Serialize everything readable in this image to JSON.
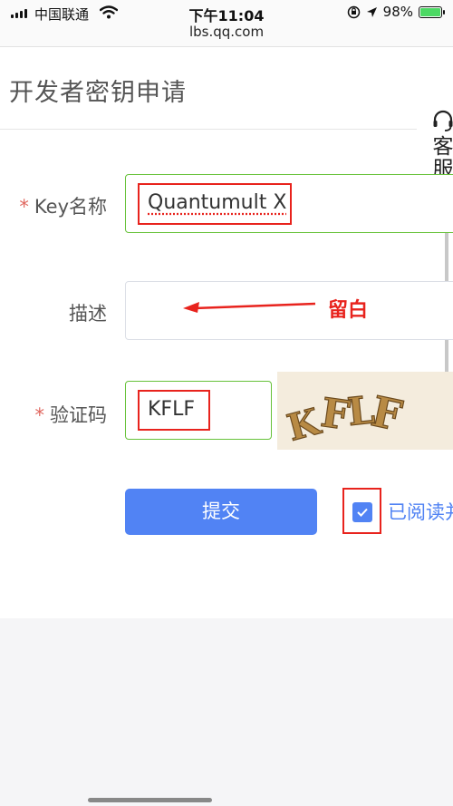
{
  "status_bar": {
    "carrier": "中国联通",
    "time": "下午11:04",
    "battery_percent": "98%",
    "battery_level": 0.98
  },
  "url": "lbs.qq.com",
  "page": {
    "title": "开发者密钥申请",
    "service": {
      "line1": "客",
      "line2": "服"
    }
  },
  "form": {
    "key_name": {
      "required_mark": "*",
      "label": "Key名称",
      "value": "Quantumult X"
    },
    "description": {
      "label": "描述",
      "value": ""
    },
    "captcha": {
      "required_mark": "*",
      "label": "验证码",
      "value": "KFLF"
    },
    "submit_label": "提交",
    "agreement": {
      "checked": true,
      "text": "已阅读并"
    }
  },
  "annotation": {
    "note": "留白"
  },
  "colors": {
    "accent": "#5183f4",
    "valid_border": "#67c23a",
    "annotation_red": "#e8231d",
    "required": "#e0675f"
  }
}
